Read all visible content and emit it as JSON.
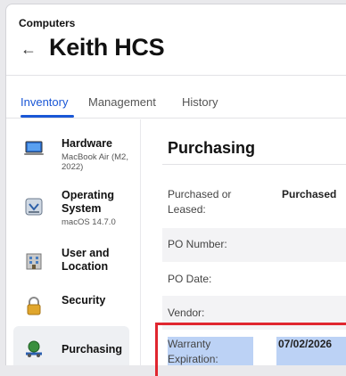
{
  "header": {
    "breadcrumb": "Computers",
    "title": "Keith HCS"
  },
  "tabs": [
    {
      "label": "Inventory"
    },
    {
      "label": "Management"
    },
    {
      "label": "History"
    }
  ],
  "sidebar": {
    "items": [
      {
        "label": "Hardware",
        "sub": "MacBook Air (M2, 2022)",
        "icon": "laptop-icon"
      },
      {
        "label": "Operating System",
        "sub": "macOS 14.7.0",
        "icon": "os-installer-icon"
      },
      {
        "label": "User and Location",
        "sub": "",
        "icon": "building-icon"
      },
      {
        "label": "Security",
        "sub": "",
        "icon": "lock-icon"
      },
      {
        "label": "Purchasing",
        "sub": "",
        "icon": "purchasing-icon"
      }
    ]
  },
  "purchasing": {
    "title": "Purchasing",
    "rows": [
      {
        "label": "Purchased or Leased:",
        "value": "Purchased"
      },
      {
        "label": "PO Number:",
        "value": ""
      },
      {
        "label": "PO Date:",
        "value": ""
      },
      {
        "label": "Vendor:",
        "value": ""
      },
      {
        "label": "Warranty Expiration:",
        "value": "07/02/2026"
      }
    ]
  },
  "colors": {
    "accent": "#1a57d6",
    "highlight": "#bcd2f5",
    "annotation_red": "#e0262f"
  }
}
